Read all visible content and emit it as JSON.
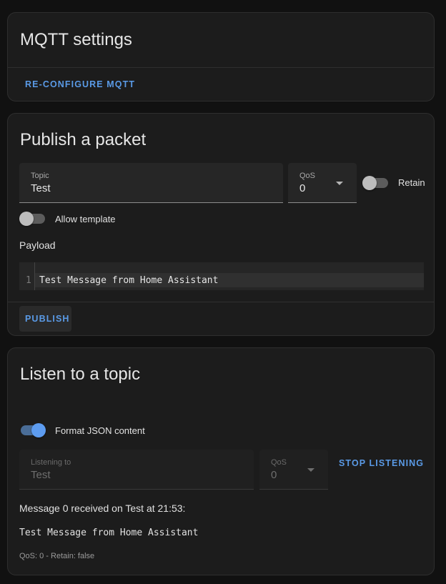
{
  "mqtt_settings": {
    "title": "MQTT settings",
    "reconfigure_label": "RE-CONFIGURE MQTT"
  },
  "publish": {
    "title": "Publish a packet",
    "topic": {
      "label": "Topic",
      "value": "Test"
    },
    "qos": {
      "label": "QoS",
      "value": "0"
    },
    "retain_label": "Retain",
    "retain_enabled": false,
    "allow_template_label": "Allow template",
    "allow_template_enabled": false,
    "payload_label": "Payload",
    "editor": {
      "line_number": "1",
      "content": "Test Message from Home Assistant"
    },
    "publish_label": "PUBLISH"
  },
  "listen": {
    "title": "Listen to a topic",
    "format_json_label": "Format JSON content",
    "format_json_enabled": true,
    "listening_to": {
      "label": "Listening to",
      "value": "Test"
    },
    "qos": {
      "label": "QoS",
      "value": "0"
    },
    "stop_label": "STOP LISTENING",
    "message": {
      "header": "Message 0 received on Test at 21:53:",
      "body": "Test Message from Home Assistant",
      "meta": "QoS: 0 - Retain: false"
    }
  },
  "colors": {
    "accent": "#5a9ae6",
    "card_background": "#1c1c1c",
    "page_background": "#111111"
  }
}
